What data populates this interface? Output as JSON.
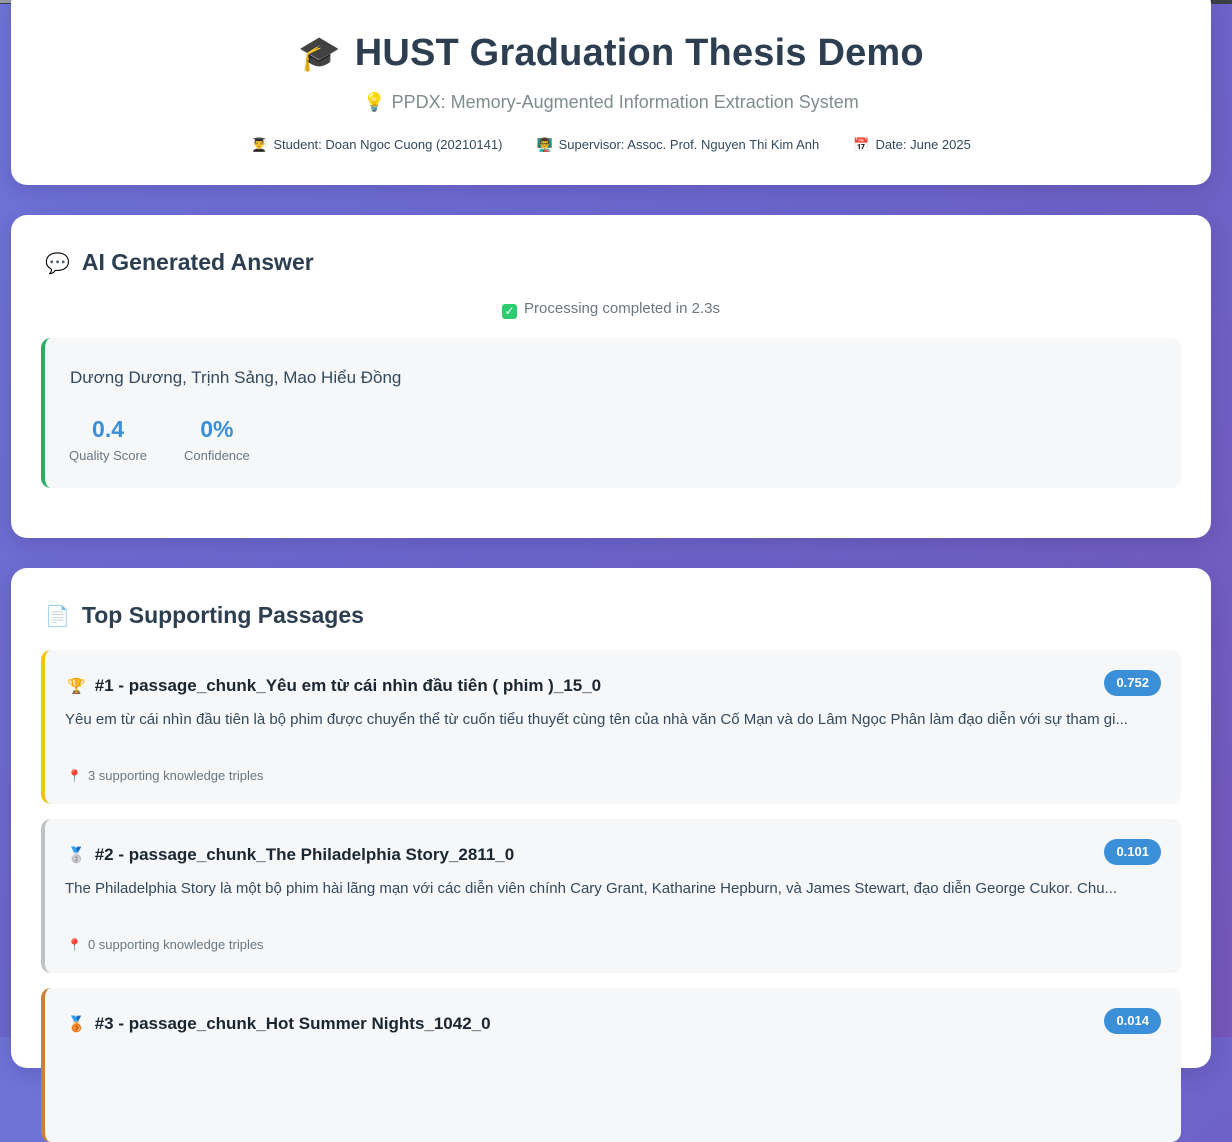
{
  "header": {
    "title_emoji": "🎓",
    "title": "HUST Graduation Thesis Demo",
    "subtitle_emoji": "💡",
    "subtitle": "PPDX: Memory-Augmented Information Extraction System",
    "student_icon": "👨‍🎓",
    "student": "Student: Doan Ngoc Cuong (20210141)",
    "supervisor_icon": "👨‍🏫",
    "supervisor": "Supervisor: Assoc. Prof. Nguyen Thi Kim Anh",
    "date_icon": "📅",
    "date": "Date: June 2025"
  },
  "answer": {
    "section_emoji": "💬",
    "section_title": "AI Generated Answer",
    "status_icon": "✓",
    "status": "Processing completed in 2.3s",
    "text": "Dương Dương, Trịnh Sảng, Mao Hiểu Đồng",
    "quality_value": "0.4",
    "quality_label": "Quality Score",
    "confidence_value": "0%",
    "confidence_label": "Confidence",
    "accent_color": "#27ae60"
  },
  "passages": {
    "section_emoji": "📄",
    "section_title": "Top Supporting Passages",
    "items": [
      {
        "medal": "🏆",
        "title": "#1 - passage_chunk_Yêu em từ cái nhìn đầu tiên ( phim )_15_0",
        "score": "0.752",
        "text": "Yêu em từ cái nhìn đầu tiên là bộ phim được chuyển thể từ cuốn tiểu thuyết cùng tên của nhà văn Cố Mạn và do Lâm Ngọc Phân làm đạo diễn với sự tham gi...",
        "triples_icon": "📍",
        "triples": "3 supporting knowledge triples",
        "border_color": "#f1c40f"
      },
      {
        "medal": "🥈",
        "title": "#2 - passage_chunk_The Philadelphia Story_2811_0",
        "score": "0.101",
        "text": "The Philadelphia Story là một bộ phim hài lãng mạn với các diễn viên chính Cary Grant, Katharine Hepburn, và James Stewart, đạo diễn George Cukor. Chu...",
        "triples_icon": "📍",
        "triples": "0 supporting knowledge triples",
        "border_color": "#bdc3c7"
      },
      {
        "medal": "🥉",
        "title": "#3 - passage_chunk_Hot Summer Nights_1042_0",
        "score": "0.014",
        "border_color": "#cd7f32"
      }
    ]
  }
}
